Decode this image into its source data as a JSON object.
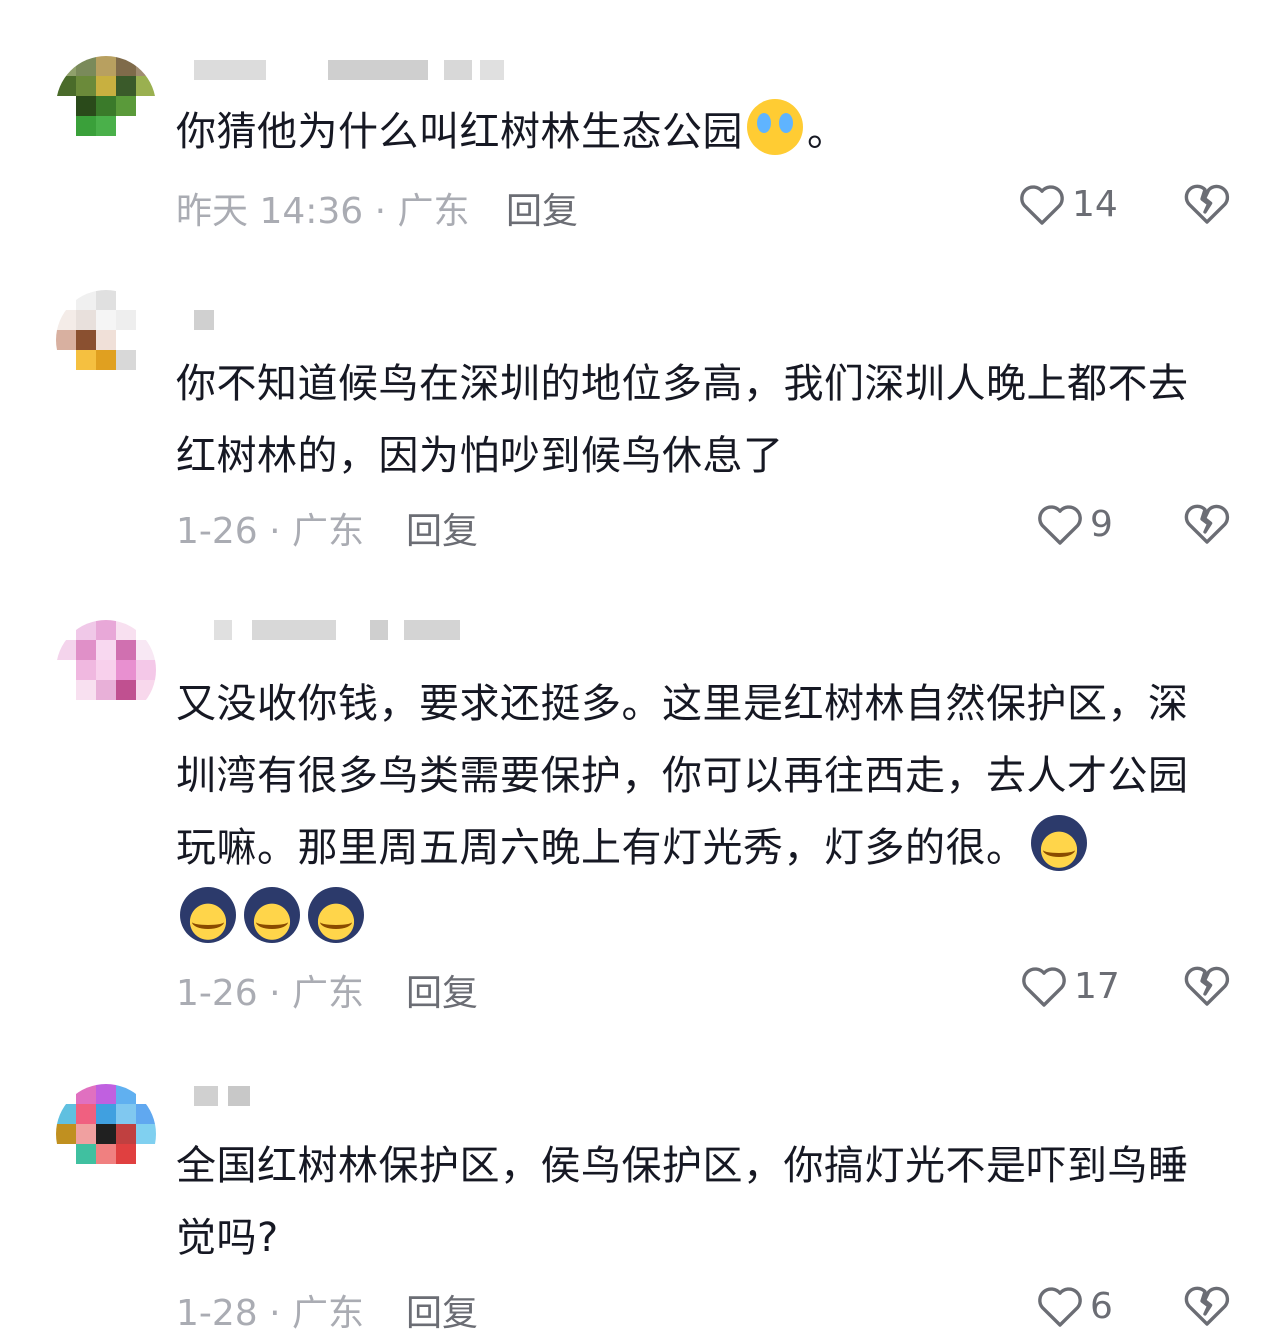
{
  "comments": [
    {
      "avatar_colors": [
        "#8fa06b",
        "#7a8a5a",
        "#b8a060",
        "#7f6b4a",
        "#a08c70",
        "#4a6b2a",
        "#6b8a3a",
        "#c8b040",
        "#3a5a2a",
        "#9ab050",
        "#ffffff",
        "#2a4a1a",
        "#3a7a2a",
        "#5a9a3a",
        "#ffffff",
        "#ffffff",
        "#3aa03a",
        "#4ab04a",
        "#ffffff",
        "#ffffff",
        "#ffffff",
        "#ffffff",
        "#ffffff",
        "#ffffff",
        "#ffffff"
      ],
      "text": "你猜他为什么叫红树林生态公园",
      "emoji_suffix": "。",
      "time": "昨天 14:36 · 广东",
      "reply": "回复",
      "likes": "14",
      "heart_icon": "heart-outline-icon",
      "dislike_icon": "broken-heart-icon"
    },
    {
      "avatar_colors": [
        "#ffffff",
        "#f0f0f0",
        "#e0e0e0",
        "#ffffff",
        "#ffffff",
        "#f4ece8",
        "#e8e0dc",
        "#f5f5f5",
        "#eeeeee",
        "#ffffff",
        "#d8b0a0",
        "#8a5030",
        "#f0e0d8",
        "#ffffff",
        "#ffffff",
        "#ffffff",
        "#f5c040",
        "#e0a020",
        "#d8d8d8",
        "#ffffff",
        "#ffffff",
        "#ffffff",
        "#ffffff",
        "#ffffff",
        "#ffffff"
      ],
      "text": "你不知道候鸟在深圳的地位多高，我们深圳人晚上都不去红树林的，因为怕吵到候鸟休息了",
      "time": "1-26 · 广东",
      "reply": "回复",
      "likes": "9",
      "heart_icon": "heart-outline-icon",
      "dislike_icon": "broken-heart-icon"
    },
    {
      "avatar_colors": [
        "#ffffff",
        "#f0c8e8",
        "#e8a8d8",
        "#f8e0f0",
        "#ffffff",
        "#f4d4ec",
        "#e090c8",
        "#f8d8f0",
        "#d070b0",
        "#f8e8f4",
        "#ffffff",
        "#f0b8e0",
        "#f8d0ec",
        "#e890d0",
        "#f4c8e8",
        "#ffffff",
        "#f8e0f0",
        "#e8b0d8",
        "#c05090",
        "#f8d8ec",
        "#ffffff",
        "#ffffff",
        "#ffffff",
        "#ffffff",
        "#ffffff"
      ],
      "text": "又没收你钱，要求还挺多。这里是红树林自然保护区，深圳湾有很多鸟类需要保护，你可以再往西走，去人才公园玩嘛。那里周五周六晚上有灯光秀，灯多的很。",
      "time": "1-26 · 广东",
      "reply": "回复",
      "likes": "17",
      "heart_icon": "heart-outline-icon",
      "dislike_icon": "broken-heart-icon"
    },
    {
      "avatar_colors": [
        "#ffffff",
        "#e070c0",
        "#c060e0",
        "#60b0f0",
        "#ffffff",
        "#60c0e0",
        "#f06080",
        "#40a0e0",
        "#80c8f0",
        "#60a8f0",
        "#c09020",
        "#f0a0a0",
        "#202020",
        "#c04040",
        "#80d0f0",
        "#ffffff",
        "#40c0a0",
        "#f08080",
        "#e04040",
        "#ffffff",
        "#ffffff",
        "#ffffff",
        "#ffffff",
        "#ffffff",
        "#ffffff"
      ],
      "text": "全国红树林保护区，侯鸟保护区，你搞灯光不是吓到鸟睡觉吗?",
      "time": "1-28 · 广东",
      "reply": "回复",
      "likes": "6",
      "heart_icon": "heart-outline-icon",
      "dislike_icon": "broken-heart-icon"
    }
  ]
}
